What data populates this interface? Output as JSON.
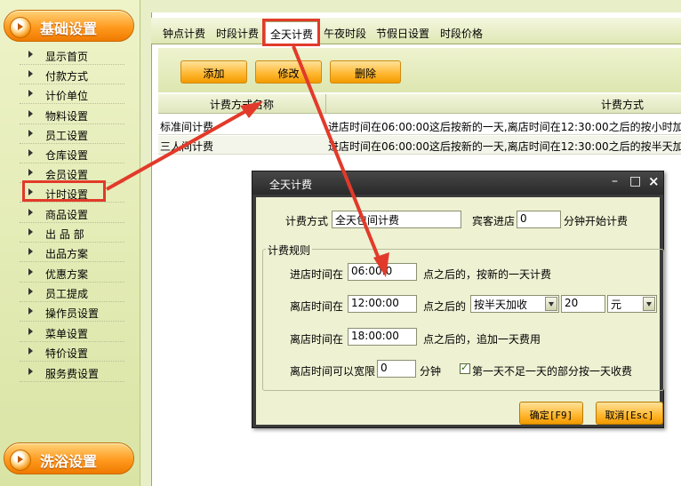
{
  "sidebar": {
    "header_top": "基础设置",
    "header_bottom": "洗浴设置",
    "items": [
      "显示首页",
      "付款方式",
      "计价单位",
      "物料设置",
      "员工设置",
      "仓库设置",
      "会员设置",
      "计时设置",
      "商品设置",
      "出 品 部",
      "出品方案",
      "优惠方案",
      "员工提成",
      "操作员设置",
      "菜单设置",
      "特价设置",
      "服务费设置"
    ]
  },
  "tabs": [
    "钟点计费",
    "时段计费",
    "全天计费",
    "午夜时段",
    "节假日设置",
    "时段价格"
  ],
  "toolbar": {
    "add": "添加",
    "edit": "修改",
    "delete": "删除"
  },
  "table": {
    "headers": [
      "计费方式名称",
      "计费方式"
    ],
    "rows": [
      [
        "标准间计费",
        "进店时间在06:00:00这后按新的一天,离店时间在12:30:00之后的按小时加收"
      ],
      [
        "三人间计费",
        "进店时间在06:00:00这后按新的一天,离店时间在12:30:00之后的按半天加收"
      ]
    ]
  },
  "dialog": {
    "title": "全天计费",
    "billing_method_label": "计费方式",
    "billing_method_value": "全天包间计费",
    "guest_entry_label": "宾客进店",
    "guest_entry_value": "0",
    "guest_entry_suffix": "分钟开始计费",
    "rules_legend": "计费规则",
    "rule1_prefix": "进店时间在",
    "rule1_time": "06:00:0",
    "rule1_suffix": "点之后的，按新的一天计费",
    "rule2_prefix": "离店时间在",
    "rule2_time": "12:00:00",
    "rule2_mid": "点之后的",
    "rule2_mode": "按半天加收",
    "rule2_amount": "20",
    "rule2_unit": "元",
    "rule3_prefix": "离店时间在",
    "rule3_time": "18:00:00",
    "rule3_suffix": "点之后的，追加一天费用",
    "grace_label": "离店时间可以宽限",
    "grace_value": "0",
    "grace_unit": "分钟",
    "checkbox_label": "第一天不足一天的部分按一天收费",
    "ok_button": "确定[F9]",
    "cancel_button": "取消[Esc]",
    "controls": {
      "minimize": "–",
      "maximize": "□",
      "close": "×"
    }
  },
  "colors": {
    "highlight": "#e23a2a",
    "accent": "#ffb62e",
    "sidebar_bg": "#e3ebb6"
  }
}
